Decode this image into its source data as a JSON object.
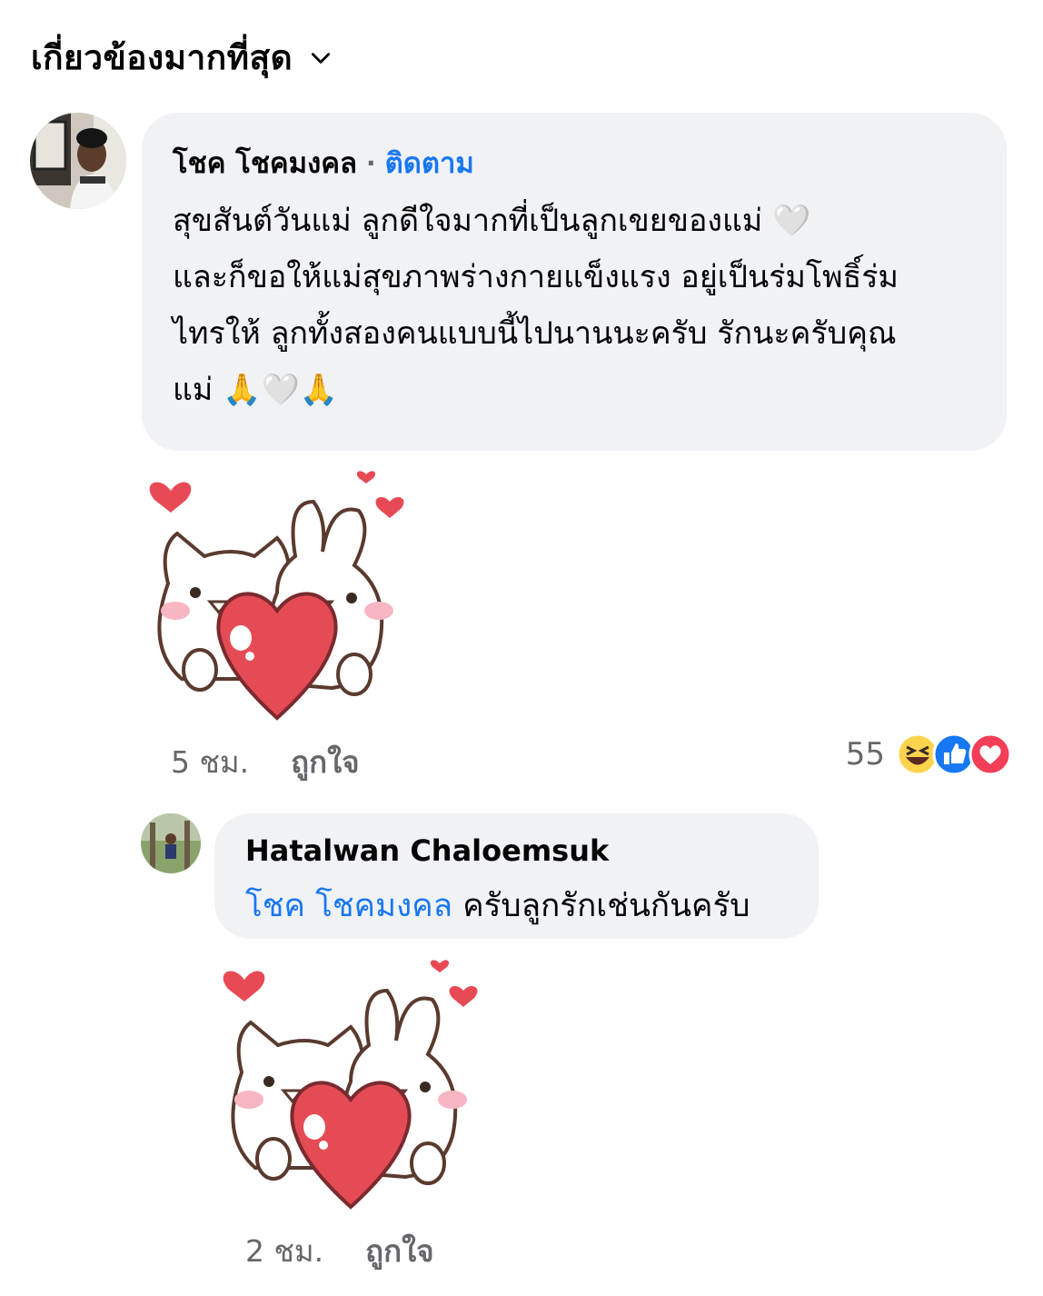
{
  "sort": {
    "label": "เกี่ยวข้องมากที่สุด",
    "icon": "chevron-down-icon"
  },
  "comment": {
    "author": "โชค โชคมงคล",
    "separator": "·",
    "follow_label": "ติดตาม",
    "lines": [
      "สุขสันต์วันแม่ ลูกดีใจมากที่เป็นลูกเขยของแม่ 🤍",
      "และก็ขอให้แม่สุขภาพร่างกายแข็งแรง อยู่เป็นร่มโพธิ์ร่ม",
      "ไทรให้ ลูกทั้งสองคนแบบนี้ไปนานนะครับ รักนะครับคุณ",
      "แม่ 🙏🤍🙏"
    ],
    "time": "5 ชม.",
    "like_label": "ถูกใจ",
    "reaction_count": "55",
    "reaction_icons": [
      "haha-icon",
      "like-reaction-icon",
      "love-reaction-icon"
    ],
    "sticker": "cat-bunny-heart-sticker"
  },
  "reply": {
    "author": "Hatalwan Chaloemsuk",
    "mention": "โชค โชคมงคล",
    "text": " ครับลูกรักเช่นกันครับ",
    "time": "2 ชม.",
    "like_label": "ถูกใจ",
    "sticker": "cat-bunny-heart-sticker"
  },
  "colors": {
    "link": "#1877f2",
    "bubble": "#f0f2f5",
    "meta": "#65676b"
  }
}
